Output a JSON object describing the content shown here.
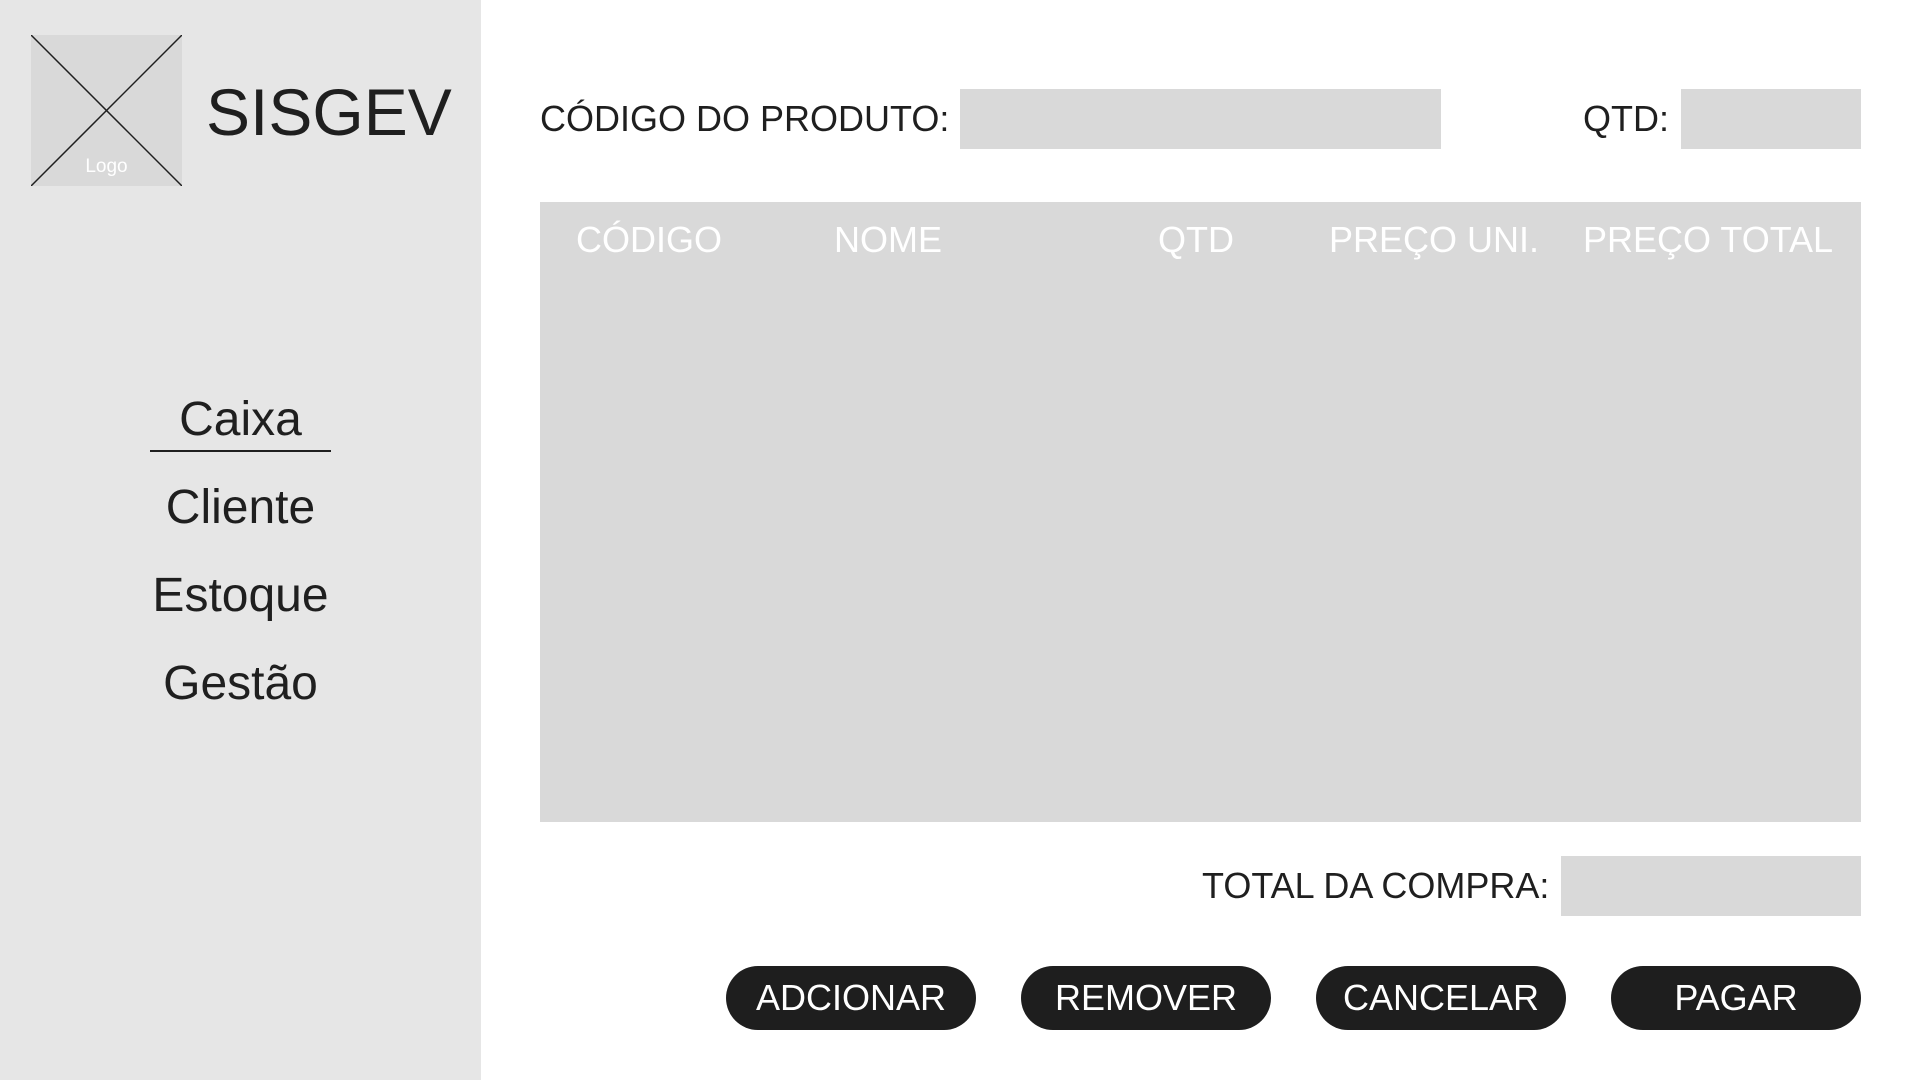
{
  "sidebar": {
    "logo_text": "Logo",
    "app_title": "SISGEV",
    "nav": [
      {
        "label": "Caixa",
        "active": true
      },
      {
        "label": "Cliente",
        "active": false
      },
      {
        "label": "Estoque",
        "active": false
      },
      {
        "label": "Gestão",
        "active": false
      }
    ]
  },
  "form": {
    "product_code_label": "CÓDIGO DO PRODUTO:",
    "product_code_value": "",
    "qty_label": "QTD:",
    "qty_value": ""
  },
  "table": {
    "columns": [
      "CÓDIGO",
      "NOME",
      "QTD",
      "PREÇO UNI.",
      "PREÇO TOTAL"
    ],
    "rows": []
  },
  "total": {
    "label": "TOTAL DA COMPRA:",
    "value": ""
  },
  "actions": {
    "add": "ADCIONAR",
    "remove": "REMOVER",
    "cancel": "CANCELAR",
    "pay": "PAGAR"
  },
  "colors": {
    "sidebar_bg": "#e6e6e6",
    "field_bg": "#d9d9d9",
    "button_bg": "#1e1e1e",
    "text": "#1f1f1f"
  }
}
